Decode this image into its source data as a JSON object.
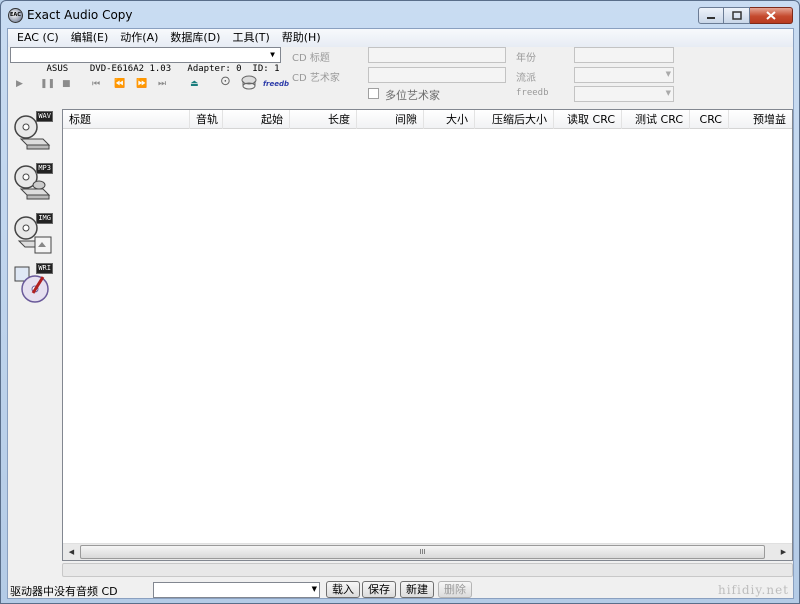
{
  "window": {
    "title": "Exact Audio Copy",
    "icon_text": "EAC"
  },
  "menu": [
    "EAC (C)",
    "编辑(E)",
    "动作(A)",
    "数据库(D)",
    "工具(T)",
    "帮助(H)"
  ],
  "drive": {
    "selected": "ASUS    DVD-E616A2 1.03   Adapter: 0  ID: 1"
  },
  "transport_icons": [
    "play-icon",
    "pause-icon",
    "stop-icon",
    "first-track-icon",
    "previous-track-icon",
    "next-track-icon",
    "last-track-icon",
    "eject-icon",
    "cd-info-icon",
    "cd-database-icon",
    "freedb-icon"
  ],
  "freedb_label": "freedb",
  "fields": {
    "cd_title_label": "CD 标题",
    "cd_artist_label": "CD 艺术家",
    "multi_artist_label": "多位艺术家",
    "year_label": "年份",
    "genre_label": "流派",
    "freedb_label": "freedb"
  },
  "side_buttons": [
    {
      "name": "wav",
      "tag": "WAV"
    },
    {
      "name": "mp3",
      "tag": "MP3"
    },
    {
      "name": "img",
      "tag": "IMG"
    },
    {
      "name": "wri",
      "tag": "WRI"
    }
  ],
  "list": {
    "columns": [
      "标题",
      "音轨",
      "起始",
      "长度",
      "间隙",
      "大小",
      "压缩后大小",
      "读取 CRC",
      "测试 CRC",
      "CRC",
      "预增益"
    ],
    "rows": []
  },
  "scrollbar_grip": "III",
  "status": {
    "text": "驱动器中没有音频 CD",
    "buttons": {
      "load": "载入",
      "save": "保存",
      "new": "新建",
      "delete": "删除"
    }
  },
  "watermark": "hifidiy.net"
}
